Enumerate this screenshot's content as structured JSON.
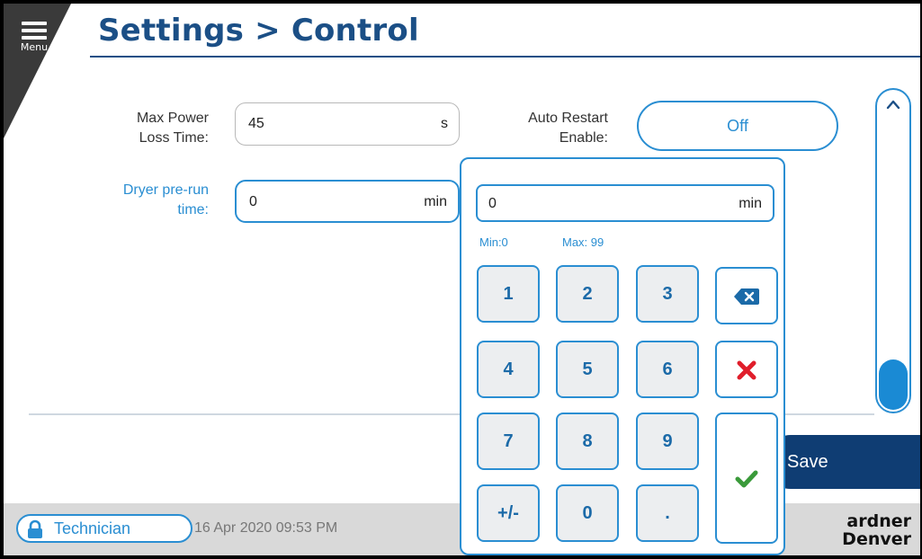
{
  "header": {
    "menu_label": "Menu",
    "title": "Settings > Control"
  },
  "fields": {
    "max_power_loss": {
      "label_line1": "Max Power",
      "label_line2": "Loss Time:",
      "value": "45",
      "unit": "s"
    },
    "dryer_prerun": {
      "label_line1": "Dryer pre-run",
      "label_line2": "time:",
      "value": "0",
      "unit": "min"
    },
    "auto_restart": {
      "label_line1": "Auto Restart",
      "label_line2": "Enable:",
      "value": "Off"
    }
  },
  "keypad": {
    "value": "0",
    "unit": "min",
    "min_label": "Min:0",
    "max_label": "Max:  99",
    "keys": {
      "k1": "1",
      "k2": "2",
      "k3": "3",
      "k4": "4",
      "k5": "5",
      "k6": "6",
      "k7": "7",
      "k8": "8",
      "k9": "9",
      "plusminus": "+/-",
      "k0": "0",
      "dot": "."
    }
  },
  "actions": {
    "save_label": "Save"
  },
  "footer": {
    "user_role": "Technician",
    "datetime": "16 Apr 2020  09:53 PM",
    "logo_line1": "ardner",
    "logo_line2": "Denver"
  },
  "colors": {
    "accent": "#2a8ed2",
    "title": "#1b4f86",
    "save": "#0f3d73",
    "cancel": "#e01e2b",
    "confirm": "#3a9a3a",
    "menu_bg": "#3a3a3a"
  },
  "icons": {
    "menu": "hamburger-icon",
    "backspace": "backspace-icon",
    "cancel": "close-icon",
    "confirm": "check-icon",
    "scroll_up": "chevron-up-icon",
    "lock": "lock-icon"
  }
}
